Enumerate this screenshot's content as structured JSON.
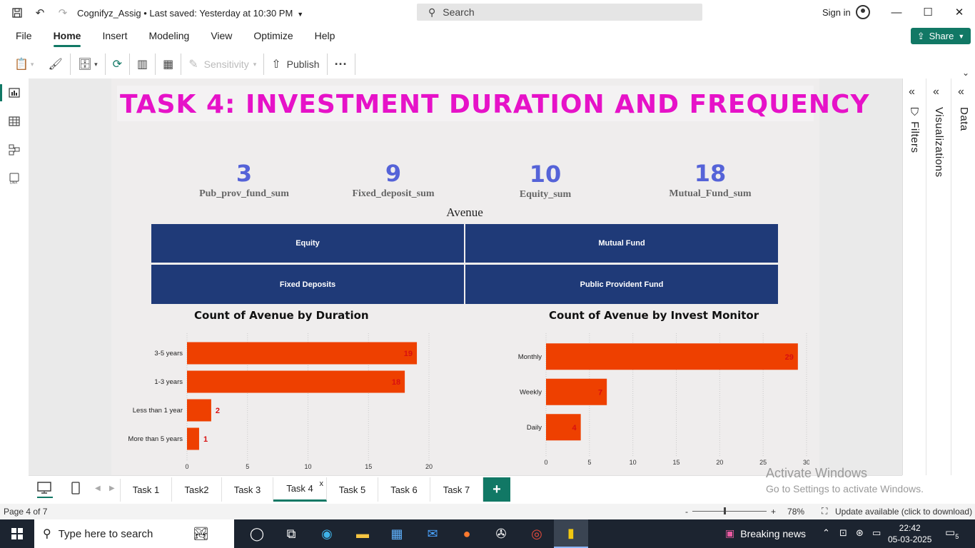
{
  "titlebar": {
    "doc_title": "Cognifyz_Assig • Last saved: Yesterday at 10:30 PM",
    "search_label": "Search",
    "sign_in": "Sign in"
  },
  "ribbon": {
    "tabs": [
      "File",
      "Home",
      "Insert",
      "Modeling",
      "View",
      "Optimize",
      "Help"
    ],
    "active_tab": "Home",
    "share_label": "Share",
    "sensitivity_label": "Sensitivity",
    "publish_label": "Publish",
    "more_label": "···"
  },
  "report": {
    "title": "TASK 4: INVESTMENT DURATION AND FREQUENCY",
    "title_color": "#e612c8",
    "kpis": [
      {
        "value": "3",
        "label": "Pub_prov_fund_sum"
      },
      {
        "value": "9",
        "label": "Fixed_deposit_sum"
      },
      {
        "value": "10",
        "label": "Equity_sum"
      },
      {
        "value": "18",
        "label": "Mutual_Fund_sum"
      }
    ],
    "avenue": {
      "title": "Avenue",
      "tiles": [
        "Equity",
        "Mutual Fund",
        "Fixed Deposits",
        "Public Provident Fund"
      ],
      "tile_color": "#1f3a78"
    }
  },
  "chart_data": [
    {
      "type": "bar",
      "orientation": "horizontal",
      "title": "Count of Avenue by Duration",
      "categories": [
        "3-5 years",
        "1-3 years",
        "Less than 1 year",
        "More than 5 years"
      ],
      "values": [
        19,
        18,
        2,
        1
      ],
      "xlim": [
        0,
        20
      ],
      "xticks": [
        0,
        5,
        10,
        15,
        20
      ],
      "bar_color": "#ee4000",
      "label_color": "#d81010",
      "grid": true
    },
    {
      "type": "bar",
      "orientation": "horizontal",
      "title": "Count of Avenue by Invest Monitor",
      "categories": [
        "Monthly",
        "Weekly",
        "Daily"
      ],
      "values": [
        29,
        7,
        4
      ],
      "xlim": [
        0,
        30
      ],
      "xticks": [
        0,
        5,
        10,
        15,
        20,
        25,
        30
      ],
      "bar_color": "#ee4000",
      "label_color": "#d81010",
      "grid": true
    }
  ],
  "pagetabs": {
    "tabs": [
      "Task 1",
      "Task2",
      "Task 3",
      "Task 4",
      "Task 5",
      "Task 6",
      "Task 7"
    ],
    "active": "Task 4",
    "close_glyph": "x",
    "add_glyph": "+"
  },
  "panes": {
    "filters": "Filters",
    "visualizations": "Visualizations",
    "data": "Data"
  },
  "watermark": {
    "line1": "Activate Windows",
    "line2": "Go to Settings to activate Windows."
  },
  "status": {
    "page": "Page 4 of 7",
    "zoom": "78%",
    "update": "Update available (click to download)"
  },
  "taskbar": {
    "search_placeholder": "Type here to search",
    "news": "Breaking news",
    "time": "22:42",
    "date": "05-03-2025",
    "notifications": "5"
  }
}
